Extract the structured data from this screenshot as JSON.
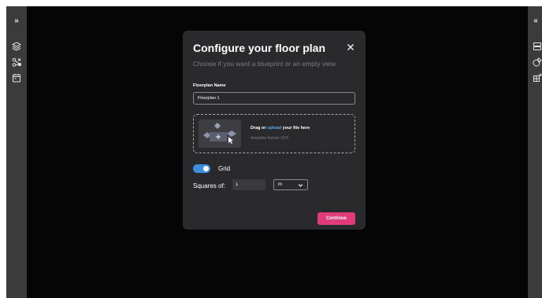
{
  "modal": {
    "title": "Configure your floor plan",
    "subtitle": "Choose if you want a blueprint or an empty view",
    "name_label": "Floorplan Name",
    "name_value": "Floorplan 1",
    "dropzone": {
      "prefix": "Drag or ",
      "link": "upload",
      "suffix": " your file here",
      "formats": "Available format: DXF"
    },
    "grid": {
      "label": "Grid",
      "enabled": true
    },
    "squares": {
      "label": "Squares of:",
      "value": "1",
      "unit": "m"
    },
    "continue_label": "Continue"
  },
  "sidebar_left": {
    "collapse_label": "»",
    "icons": [
      "layers-icon",
      "nodes-icon",
      "calendar-icon"
    ]
  },
  "sidebar_right": {
    "collapse_label": "«",
    "icons": [
      "list-icon",
      "shapes-icon",
      "grid-add-icon"
    ]
  },
  "colors": {
    "accent": "#e03c7b",
    "toggle": "#3d8fe0",
    "link": "#5aa9ef",
    "modal_bg": "#2a2a2c",
    "sidebar_bg": "#3b3b3e"
  }
}
